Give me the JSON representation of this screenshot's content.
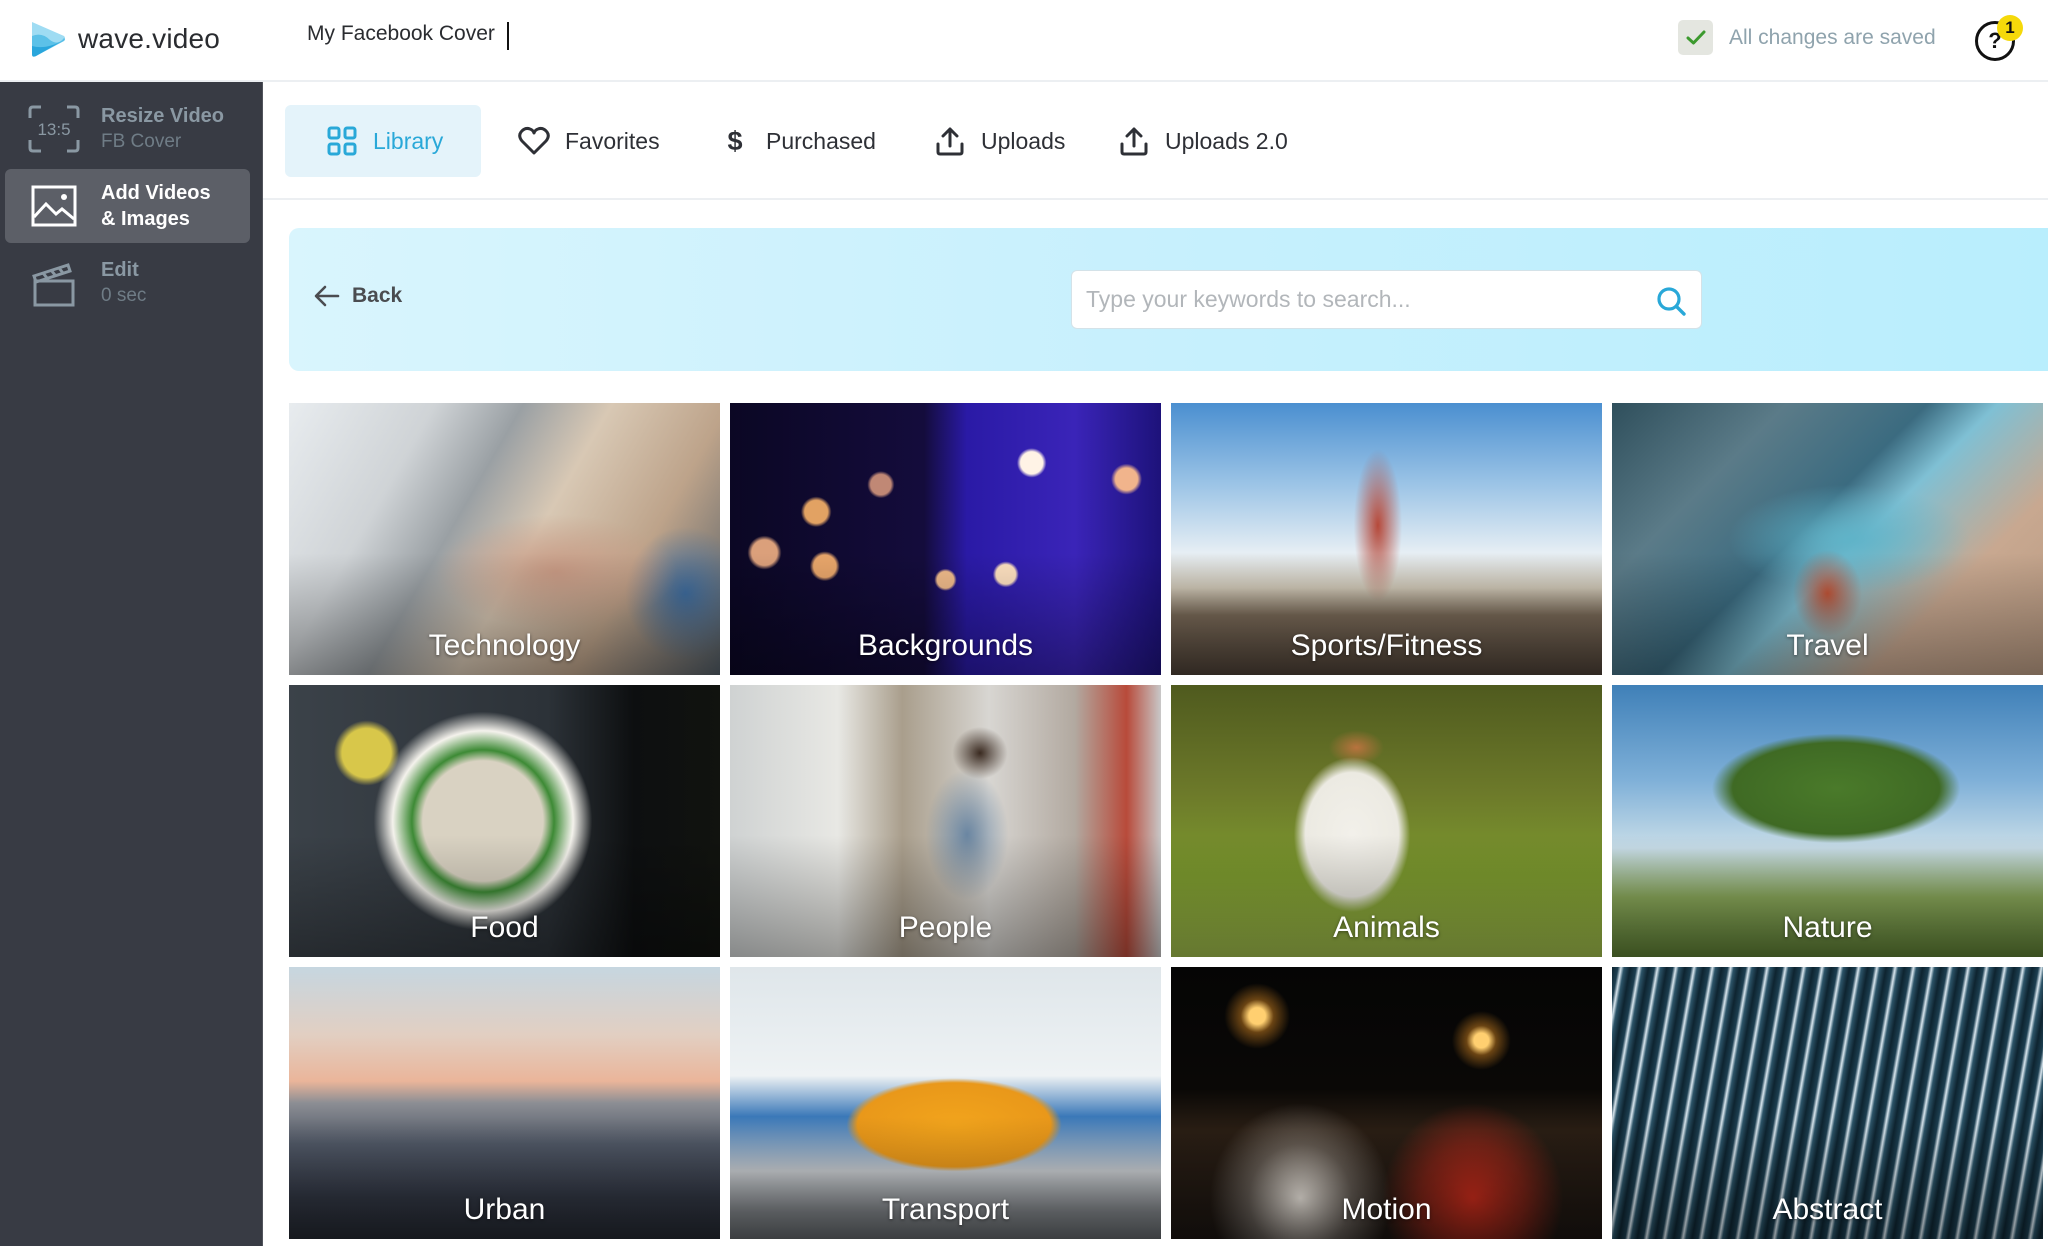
{
  "header": {
    "brand": "wave.video",
    "project_title": "My Facebook Cover",
    "save_status": "All changes are saved",
    "help_badge_count": "1",
    "accent_color": "#29a8d8",
    "badge_color": "#f5d90a"
  },
  "sidebar": {
    "items": [
      {
        "icon": "aspect-ratio-icon",
        "icon_text": "13:5",
        "title": "Resize Video",
        "subtitle": "FB Cover",
        "active": false
      },
      {
        "icon": "image-icon",
        "title": "Add Videos",
        "title2": "& Images",
        "active": true
      },
      {
        "icon": "clapperboard-icon",
        "title": "Edit",
        "subtitle": "0 sec",
        "active": false
      }
    ]
  },
  "tabs": [
    {
      "icon": "grid-icon",
      "label": "Library",
      "active": true
    },
    {
      "icon": "heart-icon",
      "label": "Favorites",
      "active": false
    },
    {
      "icon": "dollar-icon",
      "label": "Purchased",
      "active": false
    },
    {
      "icon": "upload-icon",
      "label": "Uploads",
      "active": false
    },
    {
      "icon": "upload-icon",
      "label": "Uploads 2.0",
      "active": false
    }
  ],
  "banner": {
    "back_label": "Back",
    "search_placeholder": "Type your keywords to search...",
    "search_value": ""
  },
  "categories": [
    {
      "label": "Technology"
    },
    {
      "label": "Backgrounds"
    },
    {
      "label": "Sports/Fitness"
    },
    {
      "label": "Travel"
    },
    {
      "label": "Food"
    },
    {
      "label": "People"
    },
    {
      "label": "Animals"
    },
    {
      "label": "Nature"
    },
    {
      "label": "Urban"
    },
    {
      "label": "Transport"
    },
    {
      "label": "Motion"
    },
    {
      "label": "Abstract"
    }
  ]
}
